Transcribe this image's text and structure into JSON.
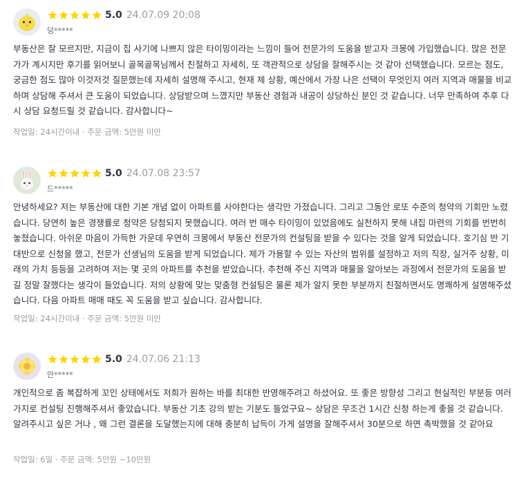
{
  "reviews": [
    {
      "avatar": "chick-icon",
      "rating": "5.0",
      "stars": 5,
      "date": "24.07.09 20:08",
      "user": "덩*****",
      "text": "부동산은 잘 모르지만, 지금이 집 사기에 나쁘지 않은 타이밍이라는 느낌이 들어 전문가의 도움을 받고자 크몽에 가입했습니다. 많은 전문가가 계시지만 후기를 읽어보니 골목골목님께서 친절하고 자세히, 또 객관적으로 상담을 잘해주시는 것 같아 선택했습니다. 모르는 점도, 궁금한 점도 많아 이것저것 질문했는데 자세히 설명해 주시고, 현재 제 상황, 예산에서 가장 나은 선택이 무엇인지 여러 지역과 매물을 비교하며 상담해 주셔서 큰 도움이 되었습니다. 상담받으며 느꼈지만 부동산 경험과 내공이 상당하신 분인 것 같습니다. 너무 만족하여 추후 다시 상담 요청드릴 것 같습니다. 감사합니다~",
      "info": "작업일: 24시간이내 · 주문 금액: 5만원 미만"
    },
    {
      "avatar": "rabbit-icon",
      "rating": "5.0",
      "stars": 5,
      "date": "24.07.08 23:57",
      "user": "드*****",
      "text": "안녕하세요? 저는 부동산에 대한 기본 개념 없이 아파트를 사야한다는 생각만 가졌습니다. 그리고 그동안 로또 수준의 청약의 기회만 노렸습니다. 당연히 높은 경쟁률로 청약은 당첨되지 못했습니다. 여러 번 매수 타이밍이 있었음에도 실천하지 못해 내집 마련의 기회를 번번히 놓쳤습니다. 아쉬운 마음이 가득한 가운데 우연히 크몽에서 부동산 전문가의 컨설팅을 받을 수 있다는 것을 알게 되었습니다. 호기심 반 기대반으로 신청을 했고, 전문가 선생님의 도움을 받게 되었습니다. 제가 가용할 수 있는 자산의 범위를 설정하고 저의 직장, 실거주 상황, 미래의 가치 등등을 고려하여 저는 몇 곳의 아파트를 추천을 받았습니다. 추천해 주신 지역과 매물을 알아보는 과정에서 전문가의 도움을 받길 정말 잘했다는 생각이 들었습니다. 저의 상황에 맞는 맞춤형 컨설팅은 물론 제가 알지 못한 부분까지 친절하면서도 명쾌하게 설명해주셨습니다. 다음 아파트 매매 때도 꼭 도움을 받고 싶습니다. 감사합니다.",
      "info": "작업일: 24시간이내 · 주문 금액: 5만원 미만"
    },
    {
      "avatar": "flower-icon",
      "rating": "5.0",
      "stars": 5,
      "date": "24.07.06 21:13",
      "user": "만*****",
      "text": "개인적으로 좀 복잡하게 꼬인 상태에서도 저희가 원하는 바를 최대한 반영해주려고 하셨어요.  또  좋은 방향성 그리고 현실적인 부분등 여러가지로 컨설팅 진행해주셔서 좋았습니다. 부동산 기초 강의 받는 기분도 들었구요~ 상담은 무조건 1시간 신청 하는게 좋을 것 같습니다. 알려주시고 싶은 거나 , 왜 그런 결론을 도달했는지에 대해 충분히 납득이 가게 설명을 잘해주셔서 30분으로 하면 촉박했을 것 같아요",
      "info": "작업일: 6일 · 주문 금액: 5만원 ~10만원"
    }
  ],
  "colors": {
    "star": "#ffd400",
    "text": "#303441",
    "muted": "#9a9ba7",
    "avatar_bg": "#eef0f3"
  }
}
